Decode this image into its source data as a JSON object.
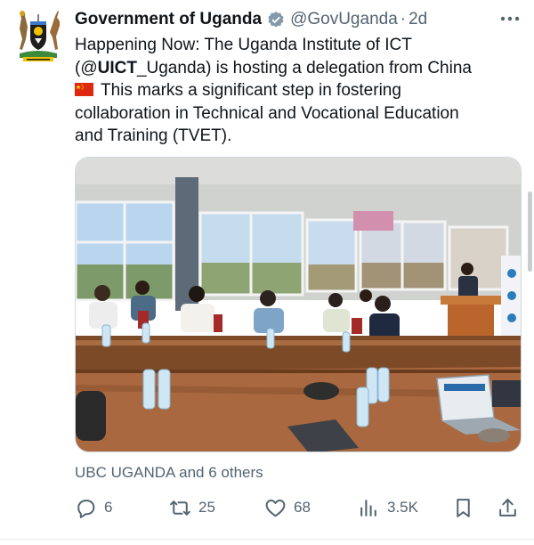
{
  "tweet": {
    "author_name": "Government of Uganda",
    "author_handle": "@GovUganda",
    "separator": "·",
    "time": "2d",
    "text_line1": "Happening Now: The Uganda Institute of ICT",
    "text_line2_prefix": "(@",
    "text_line2_bold": "UICT",
    "text_line2_suffix": "_Uganda) is hosting a delegation from China",
    "text_line3": "This marks a significant step in fostering",
    "text_line4": "collaboration in Technical and Vocational Education",
    "text_line5": "and Training (TVET).",
    "flag_icon": "china-flag",
    "liked_by": "UBC UGANDA and 6 others"
  },
  "actions": {
    "replies": "6",
    "retweets": "25",
    "likes": "68",
    "views": "3.5K"
  },
  "colors": {
    "text_primary": "#0f1419",
    "text_secondary": "#536471",
    "verified_grey": "#829aab",
    "border": "#cfd9de"
  }
}
